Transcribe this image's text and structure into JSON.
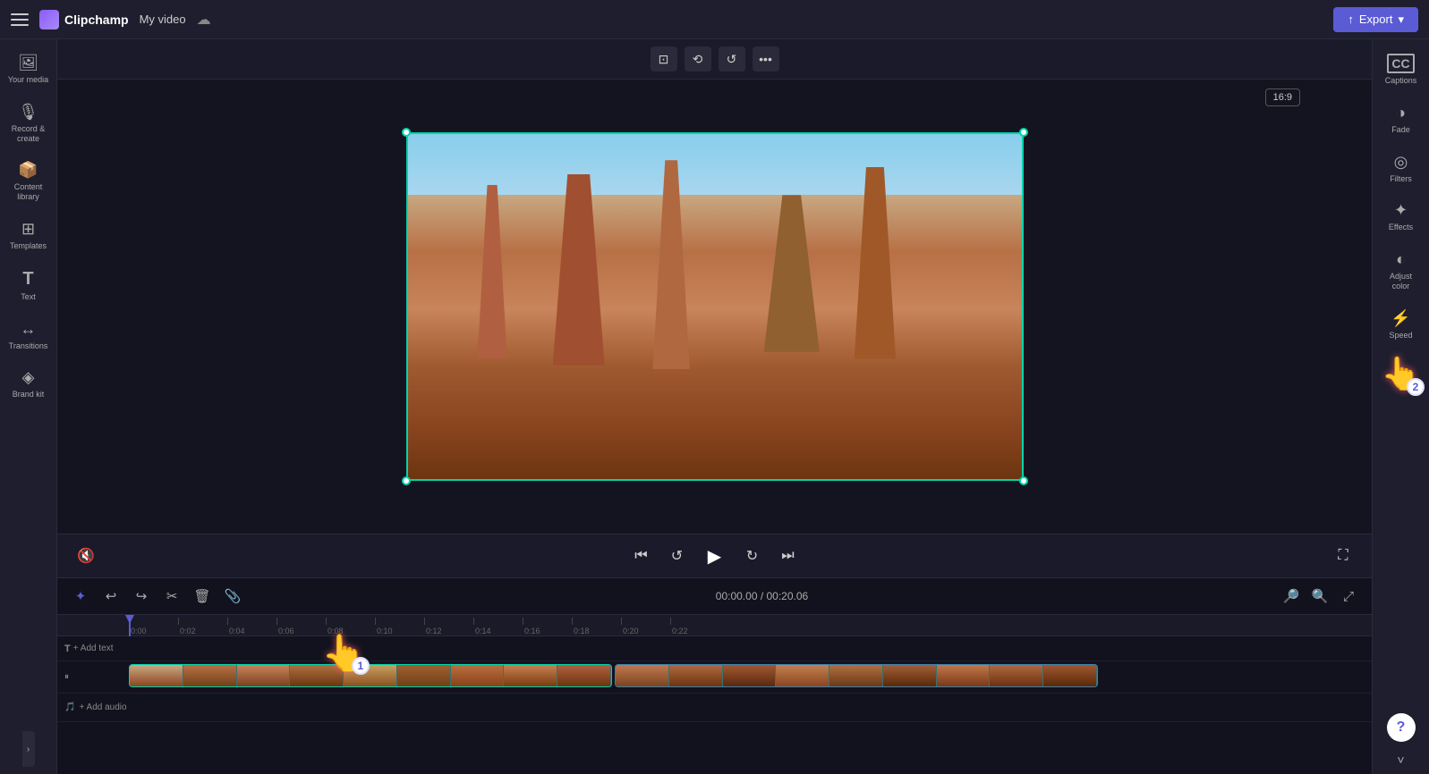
{
  "app": {
    "name": "Clipchamp",
    "title": "My video",
    "export_label": "Export"
  },
  "topbar": {
    "menu_icon": "☰",
    "cloud_icon": "☁",
    "export_arrow": "↑"
  },
  "left_sidebar": {
    "items": [
      {
        "id": "your-media",
        "label": "Your media",
        "icon": "🖼"
      },
      {
        "id": "record-create",
        "label": "Record &\ncreate",
        "icon": "🎙"
      },
      {
        "id": "content-library",
        "label": "Content\nlibrary",
        "icon": "📦"
      },
      {
        "id": "templates",
        "label": "Templates",
        "icon": "⊞"
      },
      {
        "id": "text",
        "label": "Text",
        "icon": "T"
      },
      {
        "id": "transitions",
        "label": "Transitions",
        "icon": "↔"
      },
      {
        "id": "brand-kit",
        "label": "Brand kit",
        "icon": "◈"
      }
    ]
  },
  "right_sidebar": {
    "items": [
      {
        "id": "captions",
        "label": "Captions",
        "icon": "CC"
      },
      {
        "id": "fade",
        "label": "Fade",
        "icon": "◑"
      },
      {
        "id": "filters",
        "label": "Filters",
        "icon": "◎"
      },
      {
        "id": "effects",
        "label": "Effects",
        "icon": "✦"
      },
      {
        "id": "adjust-color",
        "label": "Adjust\ncolor",
        "icon": "◐"
      },
      {
        "id": "speed",
        "label": "Speed",
        "icon": "⚡"
      }
    ]
  },
  "video_toolbar": {
    "crop_icon": "⊡",
    "rotate_icon": "⟲",
    "undo_icon": "↺",
    "more_icon": "•••"
  },
  "video_controls": {
    "time_current": "00:00.00",
    "time_total": "00:20.06",
    "time_separator": "/",
    "skip_back_icon": "⏮",
    "replay_icon": "↺",
    "play_icon": "▶",
    "forward_icon": "↻",
    "skip_next_icon": "⏭",
    "fullscreen_icon": "⛶",
    "mute_icon": "🔇"
  },
  "timeline": {
    "toolbar": {
      "magic_icon": "✦",
      "undo_icon": "↩",
      "redo_icon": "↪",
      "cut_icon": "✂",
      "delete_icon": "🗑",
      "add_media_icon": "➕",
      "zoom_in_icon": "🔍",
      "zoom_out_icon": "🔎",
      "expand_icon": "⤢"
    },
    "time_display": "00:00.00 / 00:20.06",
    "ruler_marks": [
      "0:00",
      "0:02",
      "0:04",
      "0:06",
      "0:08",
      "0:10",
      "0:12",
      "0:14",
      "0:16",
      "0:18",
      "0:20",
      "0:22"
    ],
    "tracks": {
      "text_add_label": "+ Add text",
      "audio_add_label": "+ Add audio"
    }
  },
  "aspect_ratio": "16:9",
  "cursor_annotations": [
    {
      "id": "cursor-1",
      "number": "1"
    },
    {
      "id": "cursor-2",
      "number": "2"
    }
  ]
}
